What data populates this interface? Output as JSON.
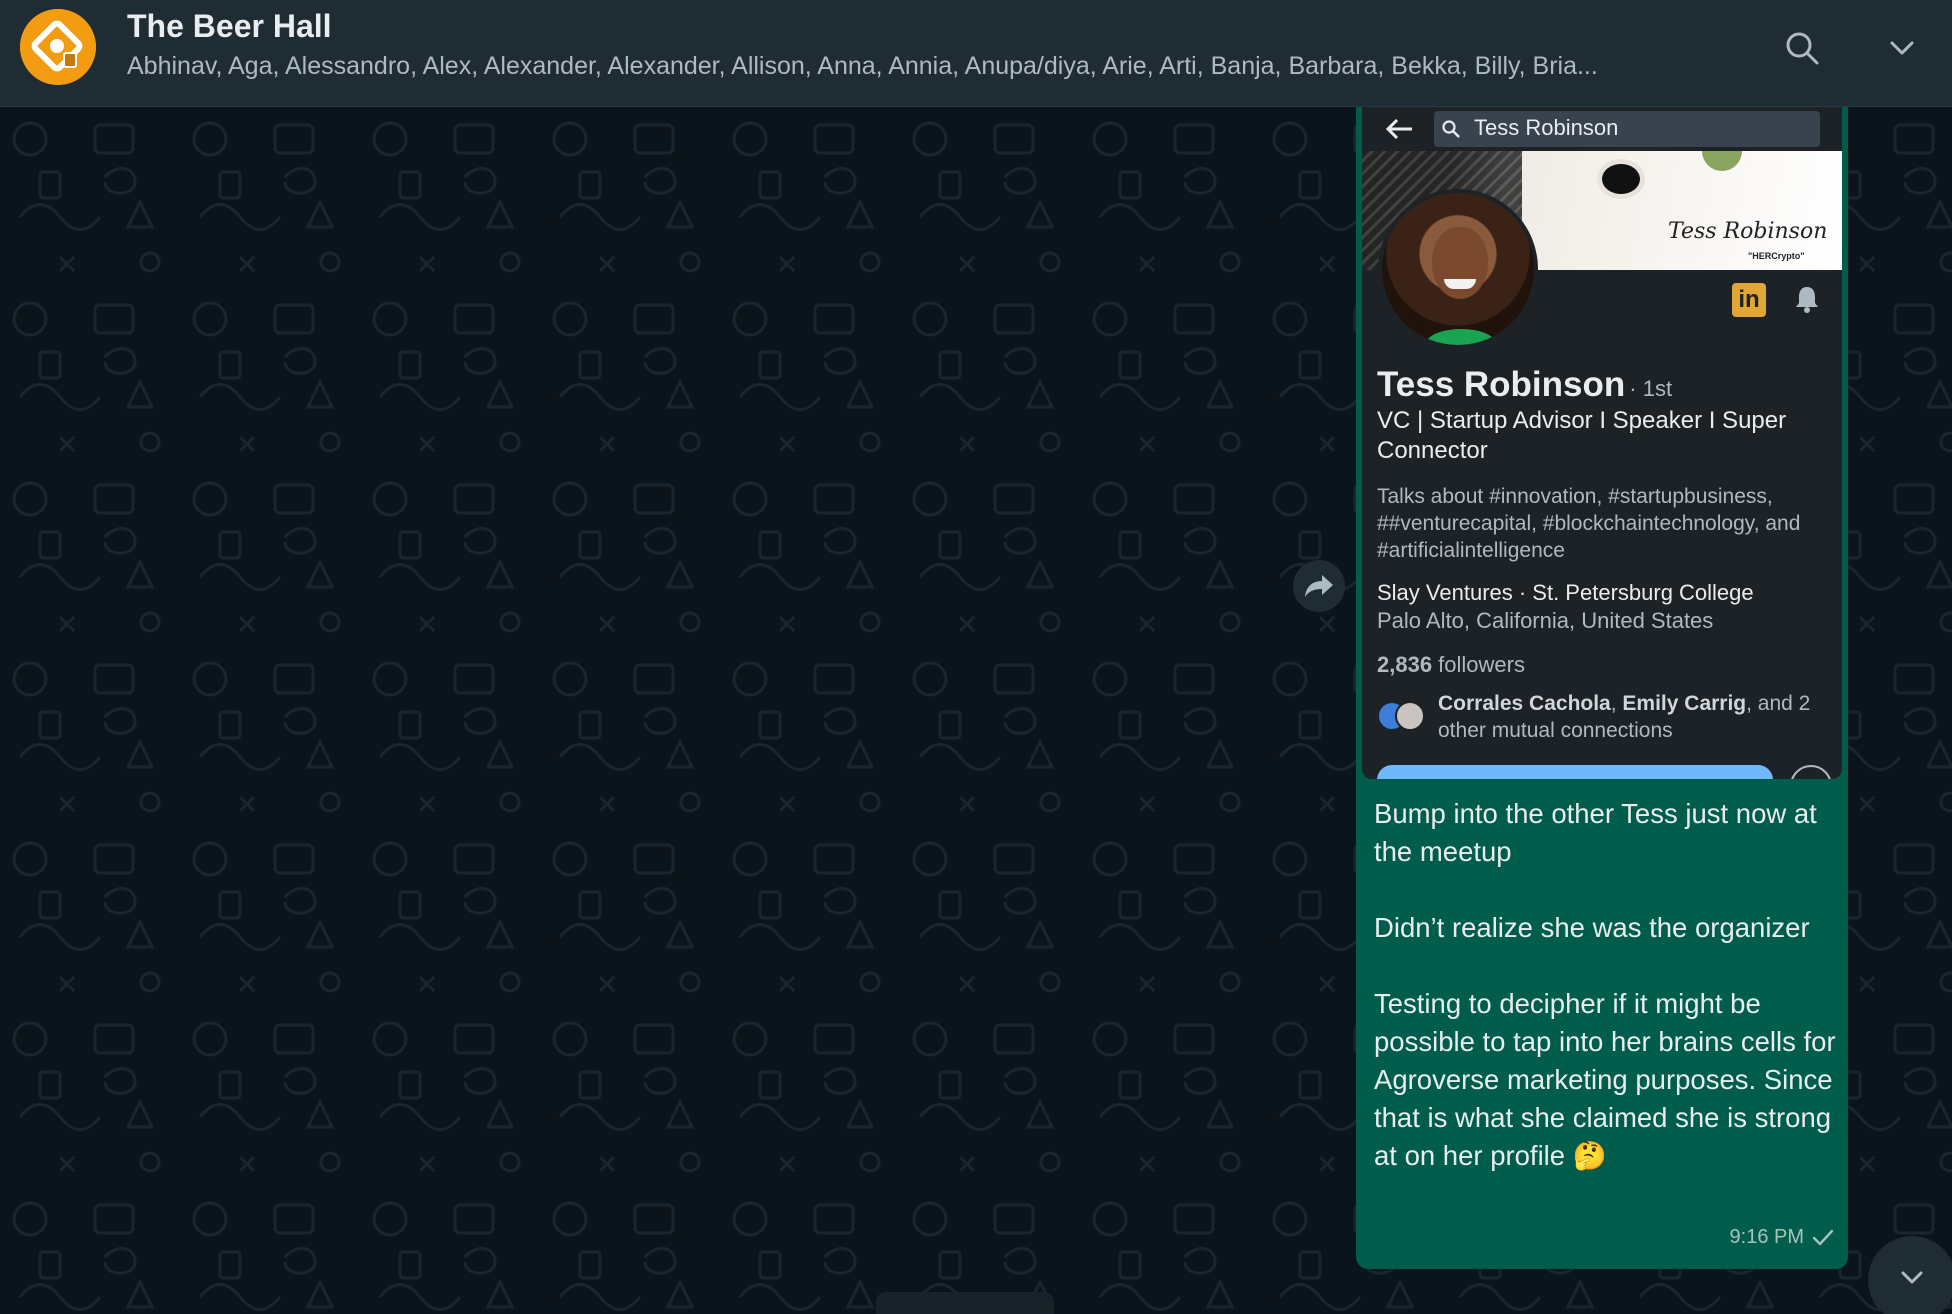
{
  "header": {
    "title": "The Beer Hall",
    "members": "Abhinav, Aga, Alessandro, Alex, Alexander, Alexander, Allison, Anna, Annia, Anupa/diya, Arie, Arti, Banja, Barbara, Bekka, Billy, Bria...",
    "search_icon": "search-icon",
    "menu_icon": "chevron-down-icon",
    "avatar_color": "#f39c12"
  },
  "message": {
    "screenshot": {
      "search_value": "Tess Robinson",
      "banner_signature": "Tess Robinson",
      "banner_tag": "\"HERCrypto\"",
      "name": "Tess Robinson",
      "degree": "· 1st",
      "headline": "VC | Startup Advisor I Speaker I Super Connector",
      "talks_about": "Talks about #innovation, #startupbusiness, ##venturecapital, #blockchaintechnology, and #artificialintelligence",
      "company": "Slay Ventures · St. Petersburg College",
      "location": "Palo Alto, California, United States",
      "followers_count": "2,836",
      "followers_label": " followers",
      "mutual_name_1": "Corrales Cachola",
      "mutual_sep": ", ",
      "mutual_name_2": "Emily Carrig",
      "mutual_rest": ", and 2 other mutual connections",
      "linkedin_icon": "linkedin-icon",
      "bell_icon": "bell-icon"
    },
    "text": "Bump into the other Tess just now at the meetup\n\nDidn’t realize she was the organizer\n\nTesting to decipher if it might be possible to tap into her brains cells for Agroverse marketing purposes. Since that is what she claimed she is strong at on her profile 🤔",
    "time": "9:16 PM",
    "status_icon": "check-icon",
    "bubble_color": "#005c4b"
  },
  "colors": {
    "header_bg": "#202c33",
    "chat_bg": "#0b141a",
    "accent_linkedin": "#e2a636"
  }
}
